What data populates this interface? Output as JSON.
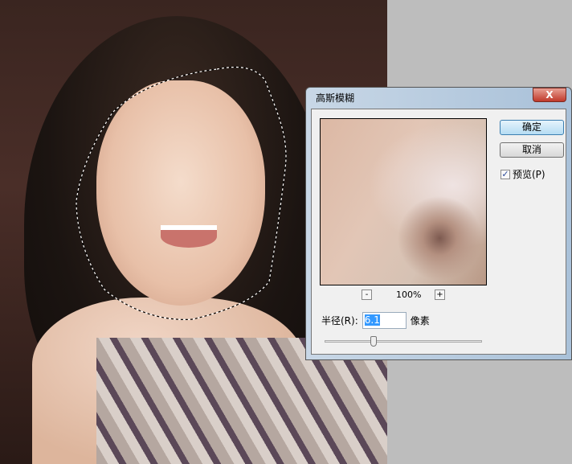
{
  "dialog": {
    "title": "高斯模糊",
    "close_label": "X",
    "ok_label": "确定",
    "cancel_label": "取消",
    "preview_label": "预览(P)",
    "preview_checked": true,
    "zoom_out": "-",
    "zoom_in": "+",
    "zoom_level": "100%",
    "radius_label": "半径(R):",
    "radius_value": "6.1",
    "radius_unit": "像素",
    "slider_fraction": 0.3
  },
  "icons": {
    "close": "close-icon",
    "check": "checkmark-icon"
  }
}
